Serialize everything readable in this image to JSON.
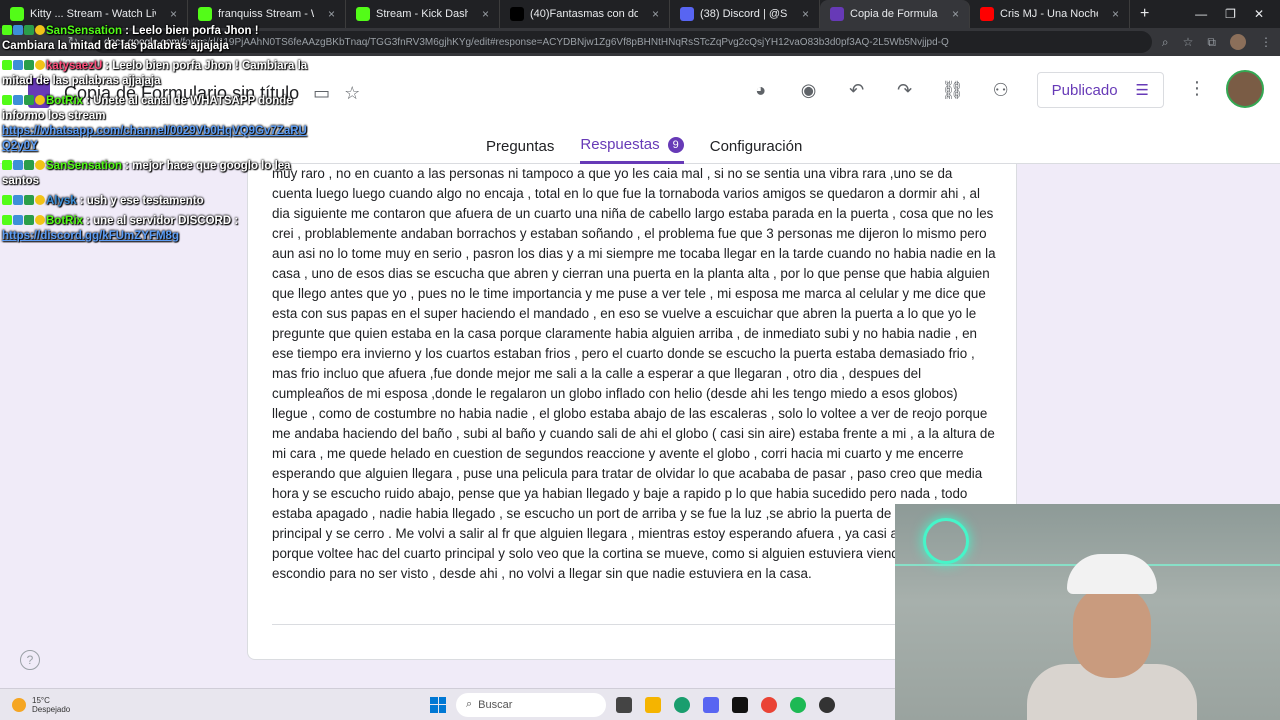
{
  "browser": {
    "tabs": [
      {
        "label": "Kitty ... Stream - Watch Live",
        "color": "#53fc18",
        "active": false
      },
      {
        "label": "franquiss Stream - Watch Live o",
        "color": "#53fc18",
        "active": false
      },
      {
        "label": "Stream - Kick Dashboard",
        "color": "#53fc18",
        "active": false
      },
      {
        "label": "(40)Fantasmas con down | TikT",
        "color": "#000000",
        "active": false
      },
      {
        "label": "(38) Discord | @S E B A S X H A",
        "color": "#5865f2",
        "active": false
      },
      {
        "label": "Copia de Formulario sin título",
        "color": "#673ab7",
        "active": true
      },
      {
        "label": "Cris MJ - Una Noche En Me",
        "color": "#ff0000",
        "active": false
      }
    ],
    "url_host": "docs.google.com",
    "url_path": "/forms/d/119PjAAhN0TS6feAAzgBKbTnaq/TGG3fnRV3M6gjhKYg/edit#response=ACYDBNjw1Zg6Vf8pBHNtHNqRsSTcZqPvg2cQsjYH12vaO83b3d0pf3AQ-2L5Wb5Nvjjpd-Q"
  },
  "forms": {
    "title": "Copia de Formulario sin título",
    "publish_label": "Publicado",
    "tabs": [
      {
        "label": "Preguntas"
      },
      {
        "label": "Respuestas",
        "count": "9"
      },
      {
        "label": "Configuración"
      }
    ],
    "accent_color": "#673ab7"
  },
  "response": {
    "answer_text": "muy raro , no en cuanto a las personas ni tampoco a que yo les caia mal , si no se sentia una vibra rara ,uno se da cuenta luego luego cuando algo no encaja , total en lo que fue la tornaboda varios amigos se quedaron a dormir ahi , al dia siguiente me contaron que afuera de un cuarto una niña de cabello largo estaba parada en la puerta , cosa que no les crei , problablemente andaban borrachos y estaban soñando , el problema fue que 3 personas me dijeron lo mismo pero aun asi no lo tome muy en serio , pasron los dias y a mi siempre me tocaba llegar en la tarde cuando no habia nadie en la casa , uno de esos dias se escucha que abren y cierran una puerta en la planta alta , por lo que pense que habia alguien que llego antes que yo , pues no le time importancia y me puse a ver tele , mi esposa me marca al celular y me dice que esta con sus papas en el super haciendo el mandado , en eso se vuelve a escuichar que abren la puerta a lo que yo le pregunte que quien estaba en la casa porque claramente habia alguien arriba , de inmediato subi y no habia nadie , en ese tiempo era invierno y los cuartos estaban frios , pero el cuarto donde se escucho la puerta estaba demasiado frio , mas frio incluo que afuera ,fue donde mejor me sali a la calle a esperar a que llegaran , otro dia , despues del cumpleaños de mi esposa ,donde le regalaron un globo inflado con helio (desde ahi les tengo miedo a esos globos) llegue , como de costumbre no habia nadie , el globo estaba abajo de las escaleras , solo lo voltee a ver de reojo porque me andaba haciendo del baño , subi al baño y cuando sali de ahi el globo ( casi sin aire) estaba frente a mi , a la altura de mi cara , me quede helado en cuestion de segundos reaccione y avente el globo , corri hacia mi cuarto y me encerre esperando que alguien llegara , puse una pelicula para tratar de olvidar lo que acababa de pasar , paso creo que media hora y se escucho ruido abajo, pense que ya habian llegado y baje a rapido p lo que habia sucedido pero nada , todo estaba apagado , nadie habia llegado , se escucho un port de arriba y se fue la luz ,se abrio la puerta de la recamara principal y se cerro . Me volvi a salir al fr que alguien llegara , mientras estoy esperando afuera , ya casi anochece y no se porque voltee hac del cuarto principal y solo veo que la cortina se mueve, como si alguien estuviera viendo para afue escondio para no ser visto , desde ahi , no volvi a llegar sin que nadie estuviera en la casa."
  },
  "chat": [
    {
      "user": "SanSensation",
      "user_color": "#53fc18",
      "text": ": Leelo bien porfa Jhon ! Cambiara la mitad de las palabras ajjajaja",
      "link": ""
    },
    {
      "user": "katysaezU",
      "user_color": "#ff4d7a",
      "text": ": Leelo bien porfa Jhon ! Cambiara la mitad de las palabras ajjajaja",
      "link": ""
    },
    {
      "user": "BotRix",
      "user_color": "#53fc18",
      "text": ": Unete al canal de WHATSAPP donde informo los stream",
      "link": "https://whatsapp.com/channel/0029Vb0HqVQ9Gv7ZaRU Q2y0Y"
    },
    {
      "user": "SanSensation",
      "user_color": "#53fc18",
      "text": ": mejor hace que googlo lo lea santos",
      "link": ""
    },
    {
      "user": "Alysk",
      "user_color": "#3d8fd8",
      "text": ": ush y ese testamento",
      "link": ""
    },
    {
      "user": "BotRix",
      "user_color": "#53fc18",
      "text": ": une al servidor DISCORD :",
      "link": "https://discord.gg/kFUmZYFM8g"
    }
  ],
  "taskbar": {
    "temperature": "15°C",
    "weather": "Despejado",
    "search_placeholder": "Buscar"
  }
}
